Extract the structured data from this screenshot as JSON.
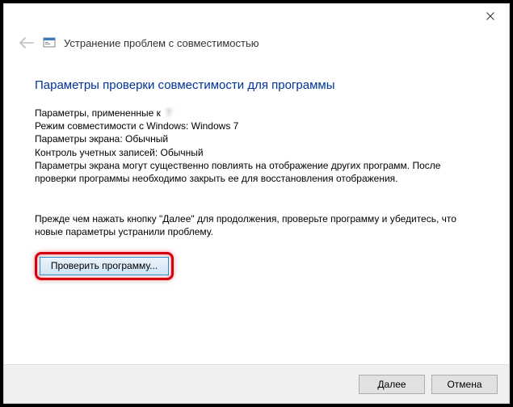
{
  "window": {
    "title": "Устранение проблем с совместимостью"
  },
  "heading": "Параметры проверки совместимости для программы",
  "params": {
    "applied_label": "Параметры, примененные к",
    "applied_value": "T",
    "compat_line": "Режим совместимости с Windows: Windows 7",
    "screen_line": "Параметры экрана:  Обычный",
    "uac_line": "Контроль учетных записей:  Обычный",
    "warning": "Параметры экрана могут существенно повлиять на отображение других программ. После проверки программы необходимо закрыть ее для восстановления отображения."
  },
  "instruction": "Прежде чем нажать кнопку \"Далее\" для продолжения, проверьте программу и убедитесь, что новые параметры устранили проблему.",
  "buttons": {
    "test": "Проверить программу...",
    "next": "Далее",
    "cancel": "Отмена"
  }
}
